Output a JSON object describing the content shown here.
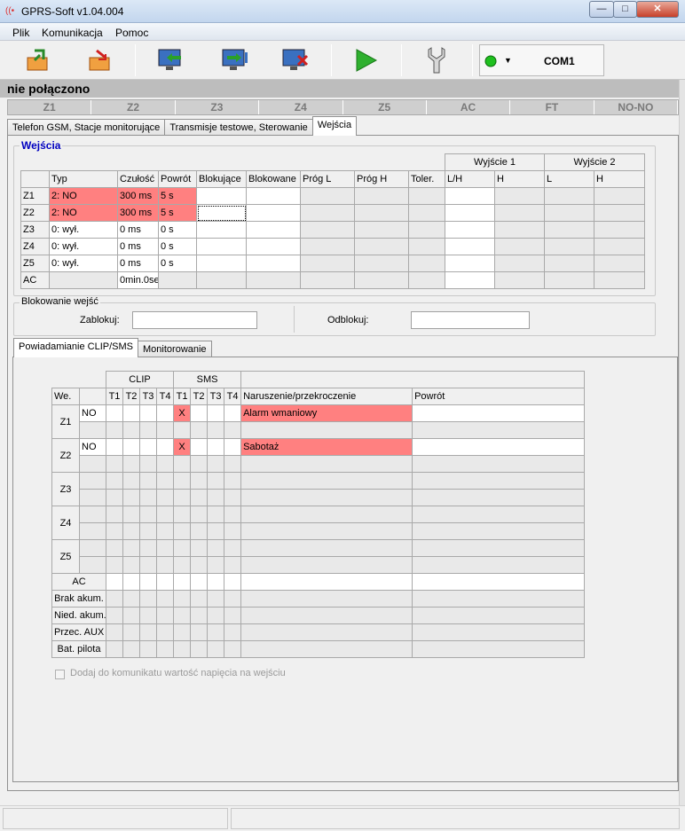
{
  "window": {
    "title": "GPRS-Soft v1.04.004",
    "min": "—",
    "max": "□",
    "close": "✕"
  },
  "menu": [
    "Plik",
    "Komunikacja",
    "Pomoc"
  ],
  "toolbar": {
    "com_port": "COM1"
  },
  "status": "nie połączono",
  "zones": [
    "Z1",
    "Z2",
    "Z3",
    "Z4",
    "Z5",
    "AC",
    "FT",
    "NO-NO"
  ],
  "tabs": [
    "Telefon GSM, Stacje monitorujące",
    "Transmisje testowe, Sterowanie",
    "Wejścia"
  ],
  "inputs": {
    "title": "Wejścia",
    "group_out1": "Wyjście 1",
    "group_out2": "Wyjście 2",
    "headers": [
      "",
      "Typ",
      "Czułość",
      "Powrót",
      "Blokujące",
      "Blokowane",
      "Próg L",
      "Próg H",
      "Toler.",
      "L/H",
      "H",
      "L",
      "H"
    ],
    "rows": [
      {
        "name": "Z1",
        "typ": "2: NO",
        "czulosc": "300 ms",
        "powrot": "5 s"
      },
      {
        "name": "Z2",
        "typ": "2: NO",
        "czulosc": "300 ms",
        "powrot": "5 s"
      },
      {
        "name": "Z3",
        "typ": "0: wył.",
        "czulosc": "0 ms",
        "powrot": "0 s"
      },
      {
        "name": "Z4",
        "typ": "0: wył.",
        "czulosc": "0 ms",
        "powrot": "0 s"
      },
      {
        "name": "Z5",
        "typ": "0: wył.",
        "czulosc": "0 ms",
        "powrot": "0 s"
      },
      {
        "name": "AC",
        "typ": "",
        "czulosc": "0min.0se",
        "powrot": ""
      }
    ]
  },
  "blocking": {
    "title": "Blokowanie wejść",
    "lock_label": "Zablokuj:",
    "unlock_label": "Odblokuj:",
    "lock_value": "",
    "unlock_value": ""
  },
  "subtabs": [
    "Powiadamianie CLIP/SMS",
    "Monitorowanie"
  ],
  "notif": {
    "clip": "CLIP",
    "sms": "SMS",
    "headers": [
      "We.",
      "",
      "T1",
      "T2",
      "T3",
      "T4",
      "T1",
      "T2",
      "T3",
      "T4",
      "Naruszenie/przekroczenie",
      "Powrót"
    ],
    "zone_rows": [
      {
        "name": "Z1",
        "mode": "NO",
        "sms_t1": "X",
        "violation": "Alarm wmaniowy"
      },
      {
        "name": "Z2",
        "mode": "NO",
        "sms_t1": "X",
        "violation": "Sabotaż"
      },
      {
        "name": "Z3",
        "mode": "",
        "sms_t1": "",
        "violation": ""
      },
      {
        "name": "Z4",
        "mode": "",
        "sms_t1": "",
        "violation": ""
      },
      {
        "name": "Z5",
        "mode": "",
        "sms_t1": "",
        "violation": ""
      }
    ],
    "extra_rows": [
      "AC",
      "Brak akum.",
      "Nied. akum.",
      "Przec. AUX",
      "Bat. pilota"
    ]
  },
  "checkbox_label": "Dodaj do komunikatu wartość napięcia na wejściu"
}
